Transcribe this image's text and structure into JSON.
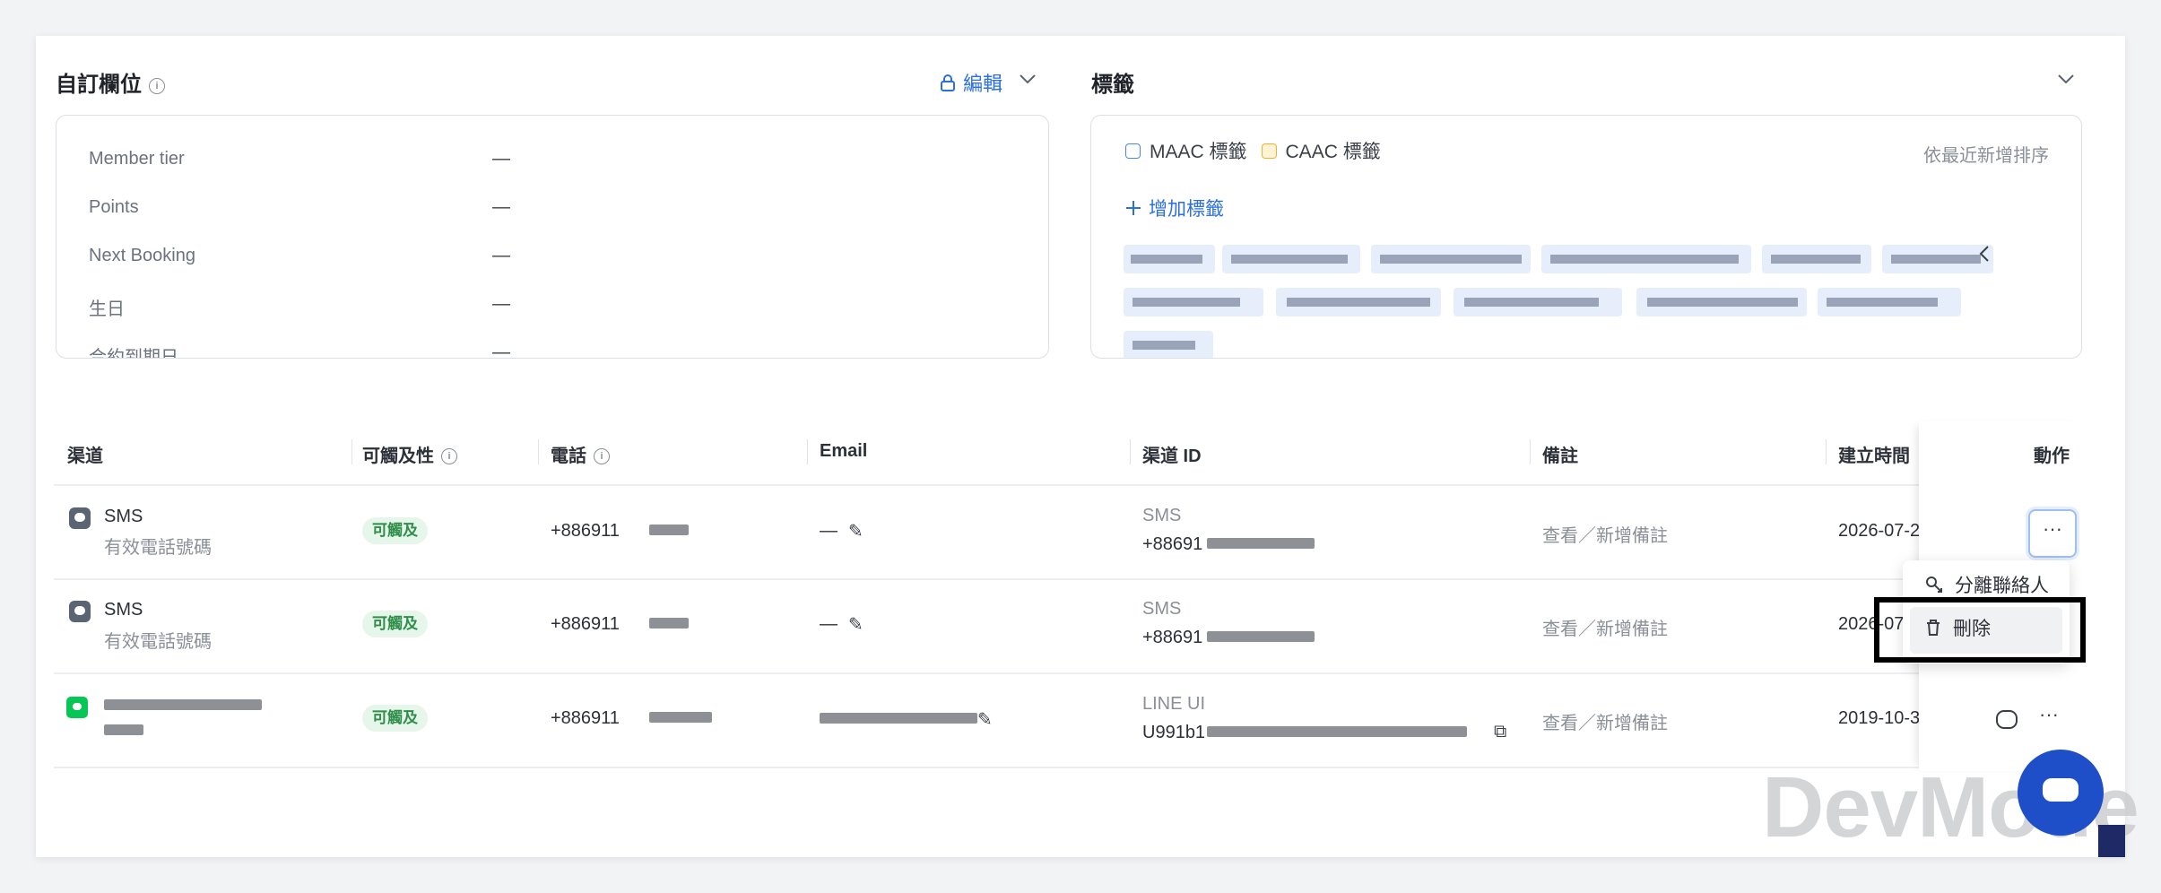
{
  "custom_fields": {
    "title": "自訂欄位",
    "edit_label": "編輯",
    "rows": [
      {
        "label": "Member tier",
        "value": "—"
      },
      {
        "label": "Points",
        "value": "—"
      },
      {
        "label": "Next Booking",
        "value": "—"
      },
      {
        "label": "生日",
        "value": "—"
      },
      {
        "label": "合約到期日",
        "value": "—"
      }
    ]
  },
  "tags": {
    "title": "標籤",
    "legend": [
      {
        "label": "MAAC 標籤",
        "color": "#4a86e8"
      },
      {
        "label": "CAAC 標籤",
        "color": "#f1b12c"
      }
    ],
    "sort_label": "依最近新增排序",
    "add_label": "增加標籤"
  },
  "table": {
    "headers": {
      "channel": "渠道",
      "reachability": "可觸及性",
      "phone": "電話",
      "email": "Email",
      "channel_id": "渠道 ID",
      "note": "備註",
      "created": "建立時間",
      "action": "動作"
    },
    "rows": [
      {
        "channel": "SMS",
        "channel_sub": "有效電話號碼",
        "badge": "可觸及",
        "phone": "+886911",
        "email": "—",
        "cid_label": "SMS",
        "cid_value": "+88691",
        "note": "查看／新增備註",
        "created": "2026-07-2"
      },
      {
        "channel": "SMS",
        "channel_sub": "有效電話號碼",
        "badge": "可觸及",
        "phone": "+886911",
        "email": "—",
        "cid_label": "SMS",
        "cid_value": "+88691",
        "note": "查看／新增備註",
        "created": "2026-07"
      },
      {
        "channel": "",
        "channel_sub": "",
        "badge": "可觸及",
        "phone": "+886911",
        "email": "",
        "cid_label": "LINE UI",
        "cid_value": "U991b1",
        "note": "查看／新增備註",
        "created": "2019-10-3"
      }
    ]
  },
  "menu": {
    "detach_label": "分離聯絡人",
    "delete_label": "刪除"
  },
  "watermark": "DevMode",
  "colors": {
    "accent": "#2b6fe0",
    "badge_bg": "#e6f6ea",
    "badge_text": "#2f8f4a",
    "line_green": "#06c755"
  }
}
